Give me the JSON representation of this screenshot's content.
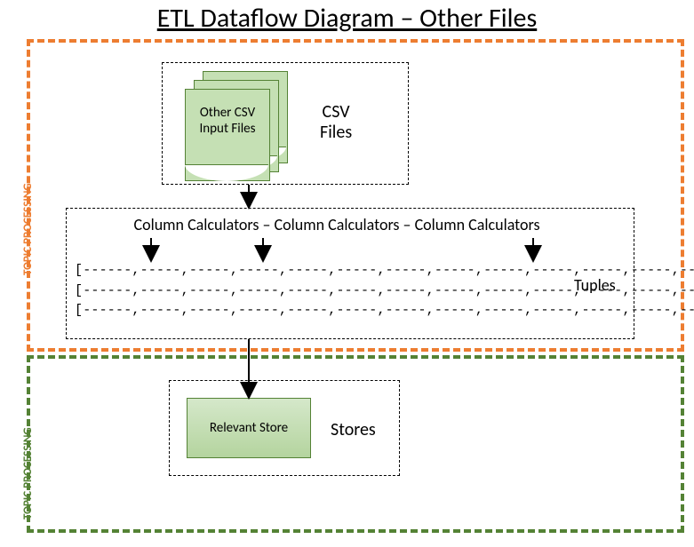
{
  "title": "ETL Dataflow Diagram – Other Files",
  "region_topic_processing_label": "TOPIC PROCESSING",
  "csv": {
    "section_label": "CSV\nFiles",
    "doc_label": "Other CSV Input Files"
  },
  "tuples": {
    "calculators_line": "Column Calculators – Column Calculators – Column Calculators",
    "section_label": "Tuples",
    "rows": [
      "[------,-----,-----,-----,-----,-----,-----,-----,-----,-----,-----,-----,-----,-----]",
      "[------,-----,-----,-----,-----,-----,-----,-----,-----,-----,-----,-----,-----,-----]",
      "[------,-----,-----,-----,-----,-----,-----,-----,-----,-----,-----,-----,-----,-----]"
    ]
  },
  "stores": {
    "section_label": "Stores",
    "store_label": "Relevant Store"
  }
}
